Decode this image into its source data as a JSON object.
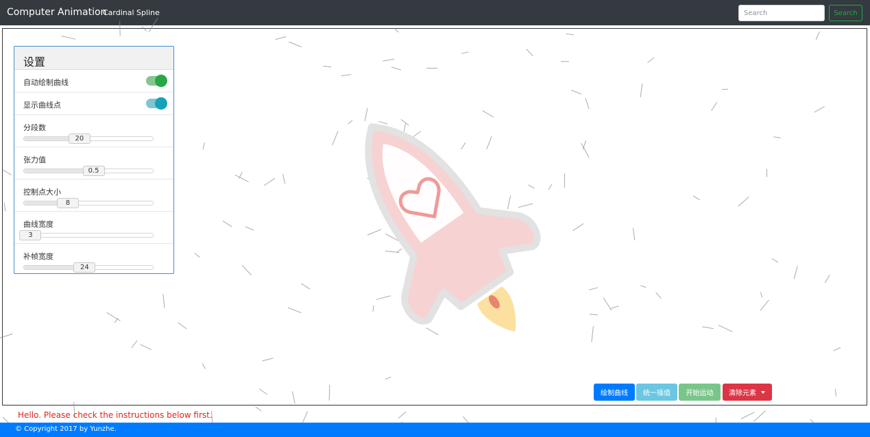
{
  "navbar": {
    "brand": "Computer Animation",
    "link": "Cardinal Spline",
    "search_placeholder": "Search",
    "search_button": "Search"
  },
  "settings": {
    "title": "设置",
    "toggles": [
      {
        "label": "自动绘制曲线",
        "on": true,
        "color": "#28a745"
      },
      {
        "label": "显示曲线点",
        "on": true,
        "color": "#17a2b8"
      }
    ],
    "sliders": [
      {
        "label": "分段数",
        "value": "20",
        "fraction": 0.43
      },
      {
        "label": "张力值",
        "value": "0.5",
        "fraction": 0.54
      },
      {
        "label": "控制点大小",
        "value": "8",
        "fraction": 0.34
      },
      {
        "label": "曲线宽度",
        "value": "3",
        "fraction": 0.05
      },
      {
        "label": "补帧宽度",
        "value": "24",
        "fraction": 0.47
      }
    ]
  },
  "actions": {
    "draw": "绘制曲线",
    "interpolate": "统一插值",
    "move": "开始运动",
    "clear": "清除元素"
  },
  "message": "Hello. Please check the instructions below first.",
  "footer": "© Copyright 2017 by Yunzhe.",
  "colors": {
    "navbar": "#343a40",
    "primary": "#007bff",
    "danger": "#dc3545",
    "rocket_body": "#f8d7d7",
    "rocket_outline": "#e4e4e4",
    "flame": "#fbe0a0"
  },
  "icons": [
    "rocket-illustration",
    "heart-icon",
    "caret-down-icon"
  ]
}
